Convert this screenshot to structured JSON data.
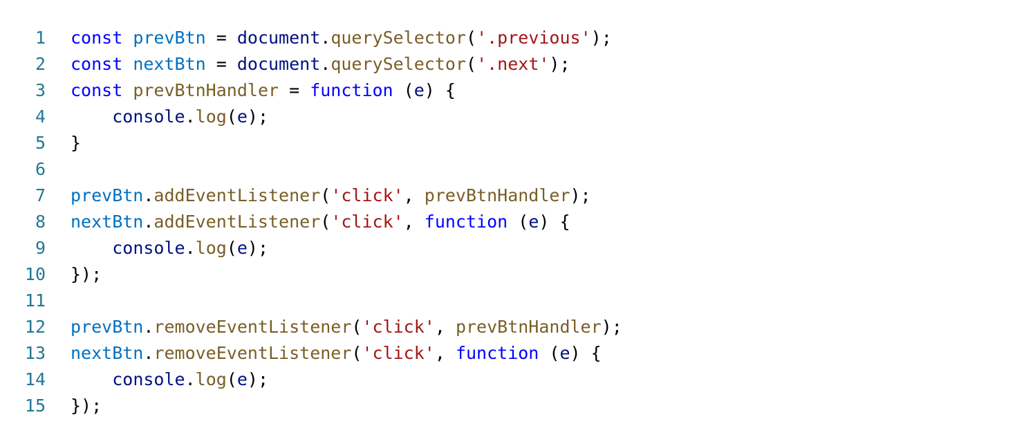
{
  "colors": {
    "line_number": "#237893",
    "keyword": "#0000ff",
    "variable": "#0070c1",
    "object": "#001080",
    "function": "#795e26",
    "string": "#a31515",
    "punctuation": "#000000"
  },
  "lines": [
    {
      "number": "1",
      "tokens": [
        {
          "t": "const",
          "c": "kw"
        },
        {
          "t": " ",
          "c": "pn"
        },
        {
          "t": "prevBtn",
          "c": "var"
        },
        {
          "t": " = ",
          "c": "pn"
        },
        {
          "t": "document",
          "c": "obj"
        },
        {
          "t": ".",
          "c": "pn"
        },
        {
          "t": "querySelector",
          "c": "fn"
        },
        {
          "t": "(",
          "c": "pn"
        },
        {
          "t": "'.previous'",
          "c": "str"
        },
        {
          "t": ");",
          "c": "pn"
        }
      ]
    },
    {
      "number": "2",
      "tokens": [
        {
          "t": "const",
          "c": "kw"
        },
        {
          "t": " ",
          "c": "pn"
        },
        {
          "t": "nextBtn",
          "c": "var"
        },
        {
          "t": " = ",
          "c": "pn"
        },
        {
          "t": "document",
          "c": "obj"
        },
        {
          "t": ".",
          "c": "pn"
        },
        {
          "t": "querySelector",
          "c": "fn"
        },
        {
          "t": "(",
          "c": "pn"
        },
        {
          "t": "'.next'",
          "c": "str"
        },
        {
          "t": ");",
          "c": "pn"
        }
      ]
    },
    {
      "number": "3",
      "tokens": [
        {
          "t": "const",
          "c": "kw"
        },
        {
          "t": " ",
          "c": "pn"
        },
        {
          "t": "prevBtnHandler",
          "c": "fn"
        },
        {
          "t": " = ",
          "c": "pn"
        },
        {
          "t": "function",
          "c": "kw"
        },
        {
          "t": " (",
          "c": "pn"
        },
        {
          "t": "e",
          "c": "obj"
        },
        {
          "t": ") {",
          "c": "pn"
        }
      ]
    },
    {
      "number": "4",
      "tokens": [
        {
          "t": "    ",
          "c": "pn"
        },
        {
          "t": "console",
          "c": "obj"
        },
        {
          "t": ".",
          "c": "pn"
        },
        {
          "t": "log",
          "c": "fn"
        },
        {
          "t": "(",
          "c": "pn"
        },
        {
          "t": "e",
          "c": "obj"
        },
        {
          "t": ");",
          "c": "pn"
        }
      ]
    },
    {
      "number": "5",
      "tokens": [
        {
          "t": "}",
          "c": "pn"
        }
      ]
    },
    {
      "number": "6",
      "tokens": []
    },
    {
      "number": "7",
      "tokens": [
        {
          "t": "prevBtn",
          "c": "var"
        },
        {
          "t": ".",
          "c": "pn"
        },
        {
          "t": "addEventListener",
          "c": "fn"
        },
        {
          "t": "(",
          "c": "pn"
        },
        {
          "t": "'click'",
          "c": "str"
        },
        {
          "t": ", ",
          "c": "pn"
        },
        {
          "t": "prevBtnHandler",
          "c": "fn"
        },
        {
          "t": ");",
          "c": "pn"
        }
      ]
    },
    {
      "number": "8",
      "tokens": [
        {
          "t": "nextBtn",
          "c": "var"
        },
        {
          "t": ".",
          "c": "pn"
        },
        {
          "t": "addEventListener",
          "c": "fn"
        },
        {
          "t": "(",
          "c": "pn"
        },
        {
          "t": "'click'",
          "c": "str"
        },
        {
          "t": ", ",
          "c": "pn"
        },
        {
          "t": "function",
          "c": "kw"
        },
        {
          "t": " (",
          "c": "pn"
        },
        {
          "t": "e",
          "c": "obj"
        },
        {
          "t": ") {",
          "c": "pn"
        }
      ]
    },
    {
      "number": "9",
      "tokens": [
        {
          "t": "    ",
          "c": "pn"
        },
        {
          "t": "console",
          "c": "obj"
        },
        {
          "t": ".",
          "c": "pn"
        },
        {
          "t": "log",
          "c": "fn"
        },
        {
          "t": "(",
          "c": "pn"
        },
        {
          "t": "e",
          "c": "obj"
        },
        {
          "t": ");",
          "c": "pn"
        }
      ]
    },
    {
      "number": "10",
      "tokens": [
        {
          "t": "});",
          "c": "pn"
        }
      ]
    },
    {
      "number": "11",
      "tokens": []
    },
    {
      "number": "12",
      "tokens": [
        {
          "t": "prevBtn",
          "c": "var"
        },
        {
          "t": ".",
          "c": "pn"
        },
        {
          "t": "removeEventListener",
          "c": "fn"
        },
        {
          "t": "(",
          "c": "pn"
        },
        {
          "t": "'click'",
          "c": "str"
        },
        {
          "t": ", ",
          "c": "pn"
        },
        {
          "t": "prevBtnHandler",
          "c": "fn"
        },
        {
          "t": ");",
          "c": "pn"
        }
      ]
    },
    {
      "number": "13",
      "tokens": [
        {
          "t": "nextBtn",
          "c": "var"
        },
        {
          "t": ".",
          "c": "pn"
        },
        {
          "t": "removeEventListener",
          "c": "fn"
        },
        {
          "t": "(",
          "c": "pn"
        },
        {
          "t": "'click'",
          "c": "str"
        },
        {
          "t": ", ",
          "c": "pn"
        },
        {
          "t": "function",
          "c": "kw"
        },
        {
          "t": " (",
          "c": "pn"
        },
        {
          "t": "e",
          "c": "obj"
        },
        {
          "t": ") {",
          "c": "pn"
        }
      ]
    },
    {
      "number": "14",
      "tokens": [
        {
          "t": "    ",
          "c": "pn"
        },
        {
          "t": "console",
          "c": "obj"
        },
        {
          "t": ".",
          "c": "pn"
        },
        {
          "t": "log",
          "c": "fn"
        },
        {
          "t": "(",
          "c": "pn"
        },
        {
          "t": "e",
          "c": "obj"
        },
        {
          "t": ");",
          "c": "pn"
        }
      ]
    },
    {
      "number": "15",
      "tokens": [
        {
          "t": "});",
          "c": "pn"
        }
      ]
    }
  ]
}
